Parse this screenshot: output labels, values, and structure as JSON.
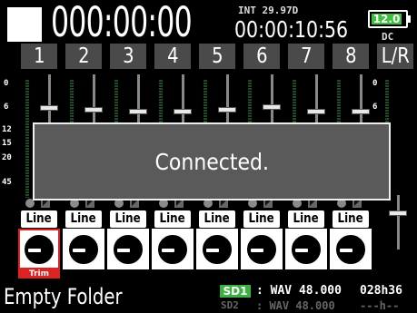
{
  "header": {
    "timecode": "000:00:00",
    "int_label": "INT 29.97D",
    "sub_timecode": "00:00:10:56",
    "battery": "12.0",
    "power": "DC"
  },
  "channels": [
    {
      "label": "1"
    },
    {
      "label": "2"
    },
    {
      "label": "3"
    },
    {
      "label": "4"
    },
    {
      "label": "5"
    },
    {
      "label": "6"
    },
    {
      "label": "7"
    },
    {
      "label": "8"
    }
  ],
  "lr_label": "L/R",
  "scale": {
    "s0": "0",
    "s6": "6",
    "s12": "12",
    "s15": "15",
    "s20": "20",
    "s45": "45"
  },
  "lr_scale": {
    "s0": "0",
    "s6": "6"
  },
  "input_label": "Line",
  "trim_label": "Trim",
  "dialog": {
    "message": "Connected."
  },
  "footer": {
    "folder": "Empty Folder",
    "sd1_badge": "SD1",
    "sd1_info": ": WAV 48.000",
    "sd2_label": "SD2",
    "sd2_info": ": WAV 48.000",
    "remaining": "028h36",
    "remaining2": "---h--"
  },
  "colors": {
    "battery": "#3cc03c",
    "sd1": "#3cb043",
    "trim": "#d22222",
    "dialog_bg": "#5a5a5a",
    "header_bg": "#4a4a4a"
  }
}
